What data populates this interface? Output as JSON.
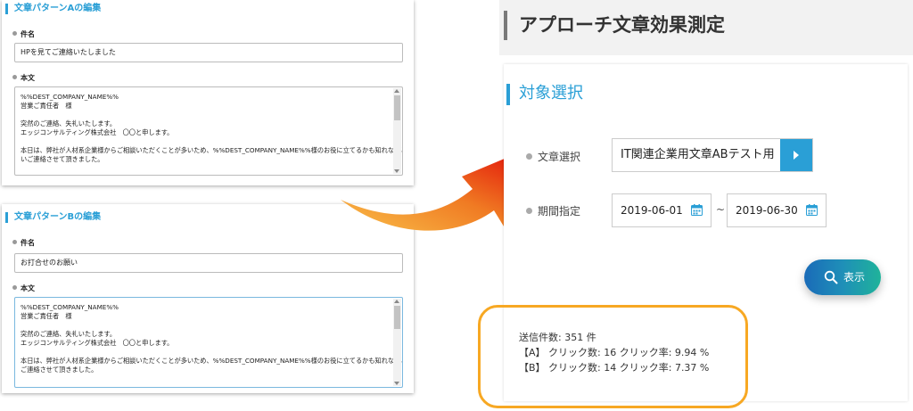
{
  "panel_a": {
    "title": "文章パターンAの編集",
    "subject_label": "件名",
    "subject_value": "HPを見てご連絡いたしました",
    "body_label": "本文",
    "body_lines": [
      "%%DEST_COMPANY_NAME%%",
      "営業ご責任者　様",
      "",
      "突然のご連絡、失礼いたします。",
      "エッジコンサルティング株式会社　〇〇と申します。",
      "",
      "本日は、弊社が人材系企業様からご相談いただくことが多いため、%%DEST_COMPANY_NAME%%様のお役に立てるかも知れないと思",
      "いご連絡させて頂きました。"
    ]
  },
  "panel_b": {
    "title": "文章パターンBの編集",
    "subject_label": "件名",
    "subject_value": "お打合せのお願い",
    "body_label": "本文",
    "body_lines": [
      "%%DEST_COMPANY_NAME%%",
      "営業ご責任者　様",
      "",
      "突然のご連絡、失礼いたします。",
      "エッジコンサルティング株式会社　〇〇と申します。",
      "",
      "本日は、弊社が人材系企業様からご相談いただくことが多いため、%%DEST_COMPANY_NAME%%様のお役に立てるかも知れないと思い",
      "ご連絡させて頂きました。"
    ]
  },
  "right": {
    "page_title": "アプローチ文章効果測定",
    "section_title": "対象選択",
    "text_select_label": "文章選択",
    "text_select_value": "IT関連企業用文章ABテスト用",
    "period_label": "期間指定",
    "date_from": "2019-06-01",
    "date_separator": "~",
    "date_to": "2019-06-30",
    "search_label": "表示",
    "results": {
      "sent_count": "送信件数: 351 件",
      "row_a": "【A】 クリック数: 16 クリック率: 9.94 %",
      "row_b": "【B】 クリック数: 14 クリック率: 7.37 %"
    }
  },
  "colors": {
    "accent": "#2a9fd6",
    "highlight": "#f7a823",
    "arrow_start": "#f9b233",
    "arrow_end": "#e3170a"
  }
}
